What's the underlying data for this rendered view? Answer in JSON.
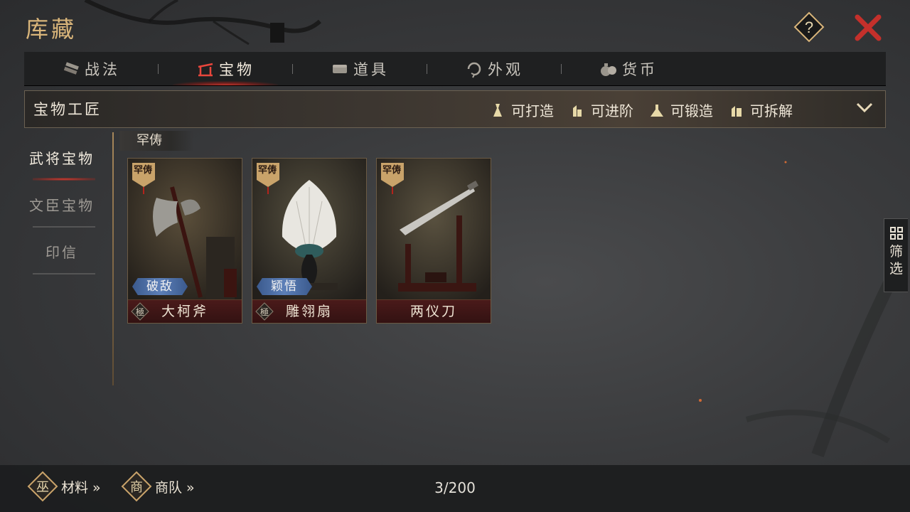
{
  "window": {
    "title": "库藏"
  },
  "header": {
    "help_label": "?"
  },
  "tabs": [
    {
      "label": "战法",
      "icon": "scroll-bundle-icon",
      "active": false
    },
    {
      "label": "宝物",
      "icon": "treasure-rack-icon",
      "active": true
    },
    {
      "label": "道具",
      "icon": "chest-icon",
      "active": false
    },
    {
      "label": "外观",
      "icon": "cycle-icon",
      "active": false
    },
    {
      "label": "货币",
      "icon": "money-bag-icon",
      "active": false
    }
  ],
  "subheader": {
    "title": "宝物工匠",
    "filters": [
      {
        "label": "可打造",
        "icon": "forge-figure-icon"
      },
      {
        "label": "可进阶",
        "icon": "advance-figure-icon"
      },
      {
        "label": "可锻造",
        "icon": "anvil-figure-icon"
      },
      {
        "label": "可拆解",
        "icon": "dismantle-figure-icon"
      }
    ]
  },
  "leftnav": [
    {
      "label": "武将宝物",
      "active": true
    },
    {
      "label": "文臣宝物",
      "active": false
    },
    {
      "label": "印信",
      "active": false
    }
  ],
  "section": {
    "title": "罕俦"
  },
  "cards": [
    {
      "name": "大柯斧",
      "badge": "罕俦",
      "skill": "破敌",
      "grade": "極"
    },
    {
      "name": "雕翎扇",
      "badge": "罕俦",
      "skill": "颖悟",
      "grade": "極"
    },
    {
      "name": "两仪刀",
      "badge": "罕俦",
      "skill": "",
      "grade": ""
    }
  ],
  "side_filter": {
    "label_top": "筛",
    "label_bottom": "选"
  },
  "bottom": {
    "materials_icon_char": "巫",
    "materials_label": "材料 »",
    "caravan_icon_char": "商",
    "caravan_label": "商队 »",
    "count": "3/200"
  },
  "colors": {
    "accent_gold": "#d9b57a",
    "close_red": "#c4302b",
    "skill_blue": "#5c7fb8"
  }
}
